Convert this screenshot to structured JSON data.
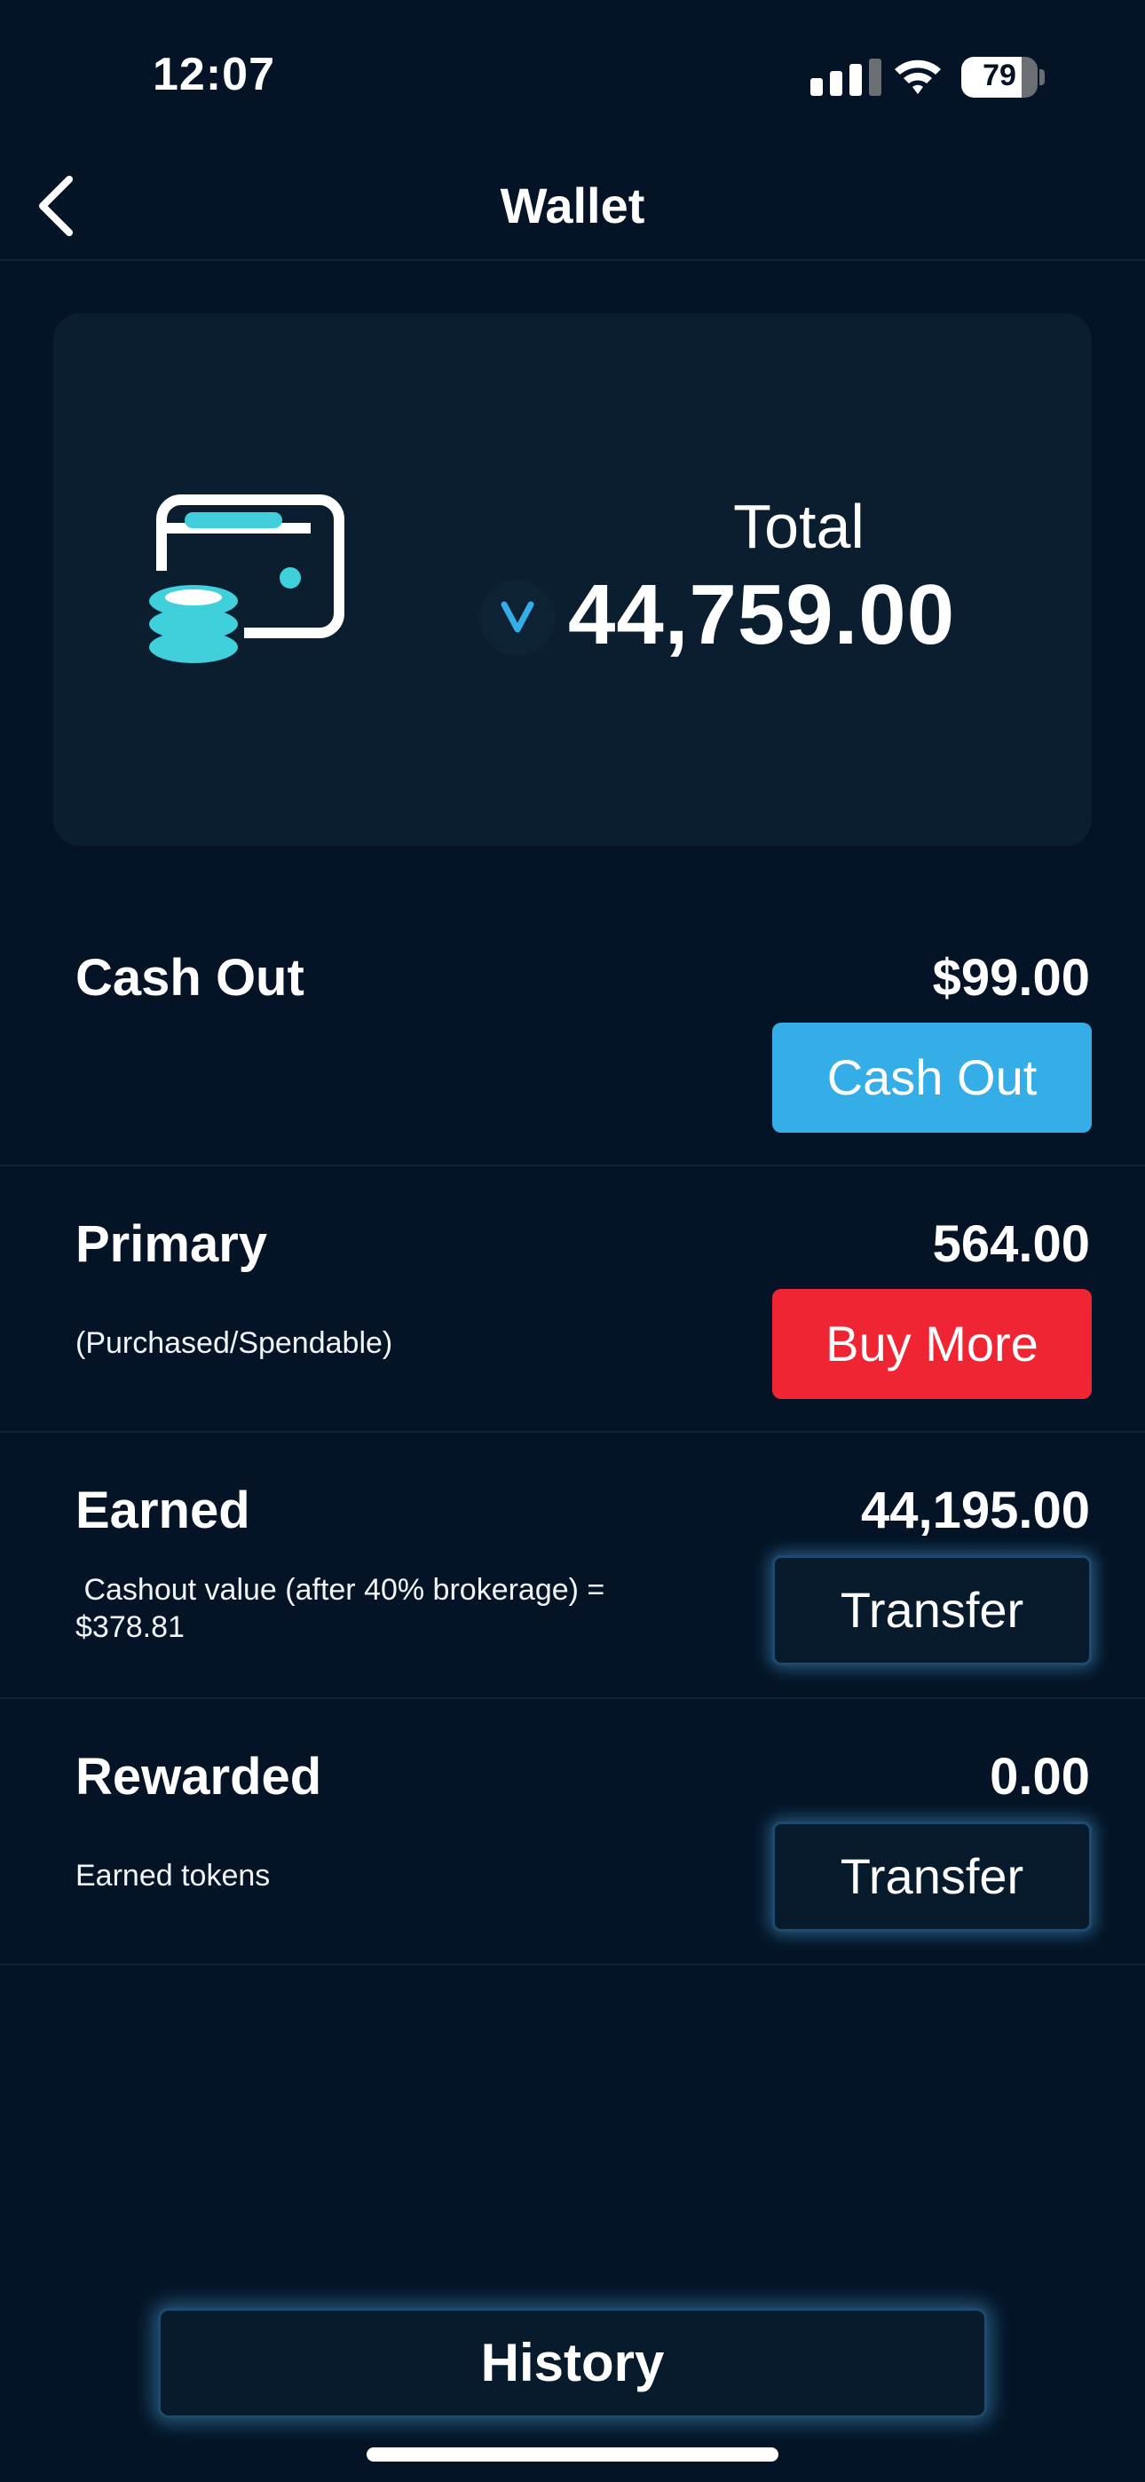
{
  "status_bar": {
    "time": "12:07",
    "battery_level": "79",
    "icons": [
      "cellular-signal-icon",
      "wifi-icon",
      "battery-icon"
    ]
  },
  "nav": {
    "title": "Wallet",
    "back_icon": "chevron-left-icon"
  },
  "total_card": {
    "label": "Total",
    "value": "44,759.00",
    "icon": "wallet-coins-icon",
    "token_icon": "v-token-icon"
  },
  "rows": [
    {
      "title": "Cash Out",
      "amount": "$99.00",
      "subtitle": "",
      "button": "Cash Out"
    },
    {
      "title": "Primary",
      "amount": "564.00",
      "subtitle": "(Purchased/Spendable)",
      "button": "Buy More"
    },
    {
      "title": "Earned",
      "amount": "44,195.00",
      "subtitle": " Cashout value (after 40% brokerage) = $378.81",
      "button": "Transfer"
    },
    {
      "title": "Rewarded",
      "amount": "0.00",
      "subtitle": "Earned tokens",
      "button": "Transfer"
    }
  ],
  "history_button": "History",
  "colors": {
    "background": "#041426",
    "card": "#0a1e30",
    "cash_out_button": "#35ade6",
    "buy_more_button": "#ef2533",
    "accent_cyan": "#3fd0dc"
  }
}
